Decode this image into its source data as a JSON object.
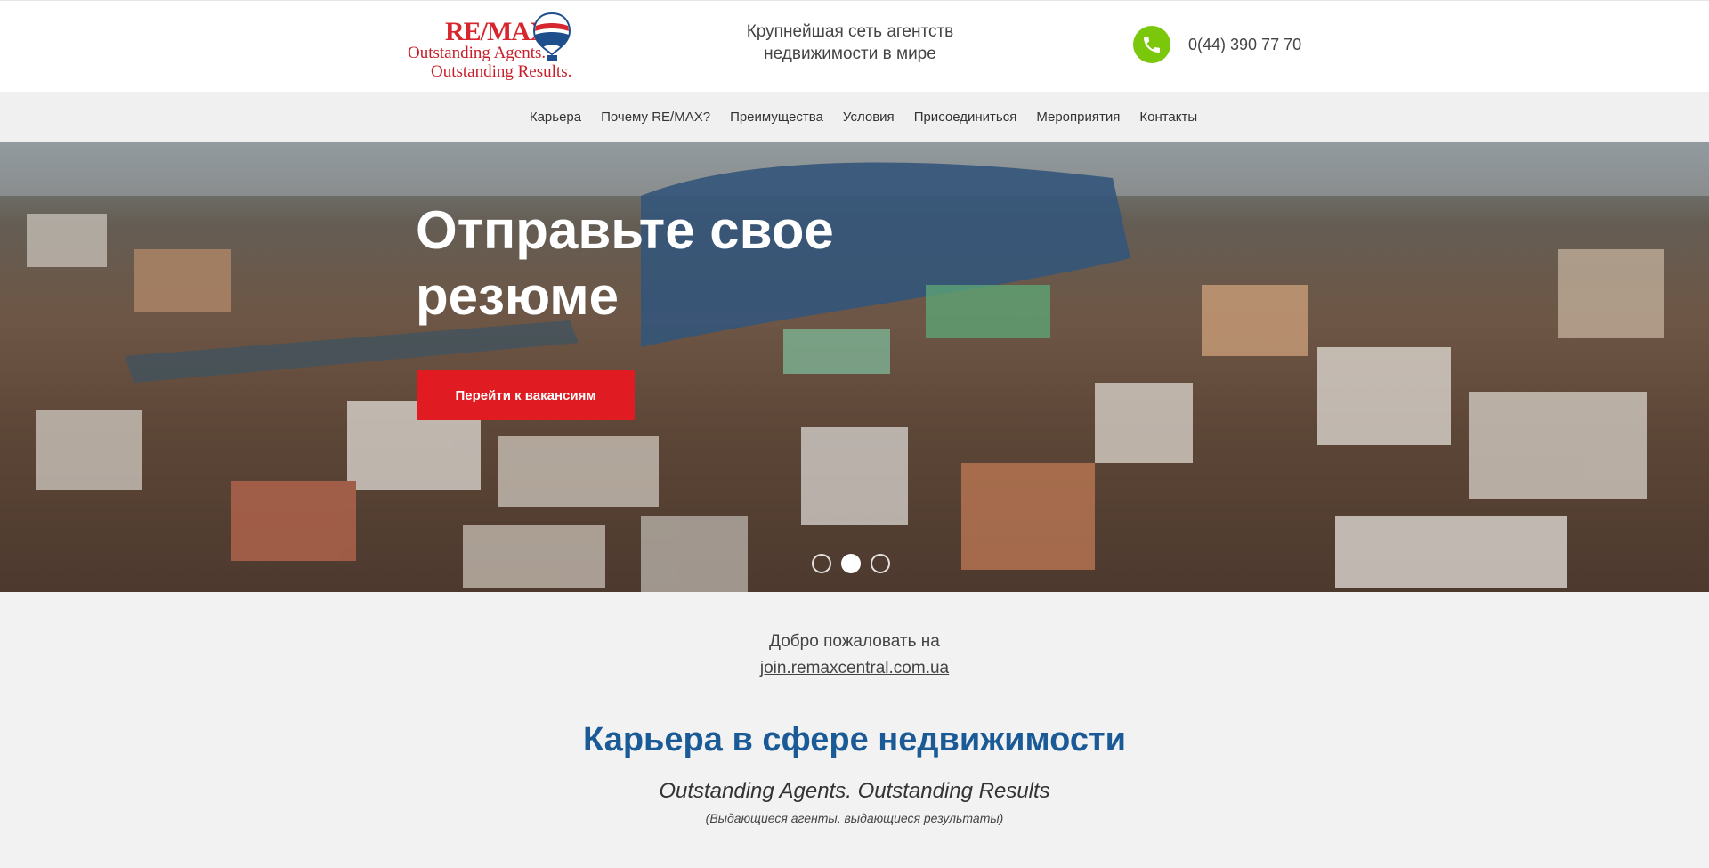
{
  "header": {
    "logo": {
      "brand": "RE/MAX",
      "line1": "Outstanding Agents.",
      "line2": "Outstanding Results."
    },
    "tagline_line1": "Крупнейшая сеть агентств",
    "tagline_line2": "недвижимости в мире",
    "phone": "0(44) 390 77 70",
    "phone_icon": "phone-icon",
    "phone_icon_color": "#7ac70c"
  },
  "nav": {
    "items": [
      {
        "label": "Карьера"
      },
      {
        "label": "Почему RE/MAX?"
      },
      {
        "label": "Преимущества"
      },
      {
        "label": "Условия"
      },
      {
        "label": "Присоединиться"
      },
      {
        "label": "Мероприятия"
      },
      {
        "label": "Контакты"
      }
    ]
  },
  "hero": {
    "title_line1": "Отправьте свое",
    "title_line2": "резюме",
    "button_label": "Перейти к вакансиям",
    "button_color": "#e11b22",
    "slides": 3,
    "active_slide": 2
  },
  "welcome": {
    "text": "Добро пожаловать на",
    "link": "join.remaxcentral.com.ua"
  },
  "career": {
    "title": "Карьера в сфере недвижимости",
    "subtitle": "Outstanding Agents. Outstanding Results",
    "note": "(Выдающиеся агенты, выдающиеся результаты)",
    "title_color": "#1a5a96"
  }
}
